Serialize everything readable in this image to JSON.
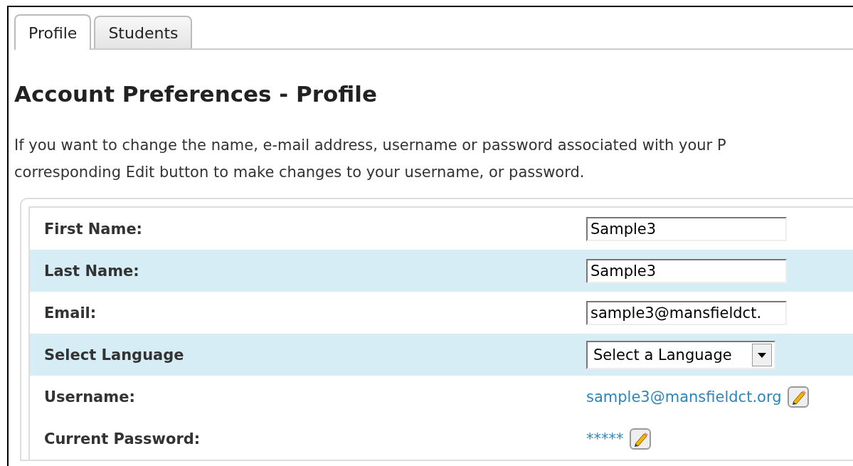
{
  "tabs": [
    {
      "label": "Profile",
      "selected": true
    },
    {
      "label": "Students",
      "selected": false
    }
  ],
  "heading": "Account Preferences - Profile",
  "intro": [
    "If you want to change the name, e-mail address, username or password associated with your P",
    "corresponding Edit button to make changes to your username, or password."
  ],
  "rows": [
    {
      "label": "First Name:",
      "kind": "input",
      "value": "Sample3",
      "shaded": false
    },
    {
      "label": "Last Name:",
      "kind": "input",
      "value": "Sample3",
      "shaded": true
    },
    {
      "label": "Email:",
      "kind": "input",
      "value": "sample3@mansfieldct.",
      "shaded": false
    },
    {
      "label": "Select Language",
      "kind": "select",
      "value": "Select a Language",
      "shaded": true
    },
    {
      "label": "Username:",
      "kind": "link",
      "value": "sample3@mansfieldct.org",
      "shaded": false
    },
    {
      "label": "Current Password:",
      "kind": "link",
      "value": "*****",
      "shaded": false
    }
  ]
}
